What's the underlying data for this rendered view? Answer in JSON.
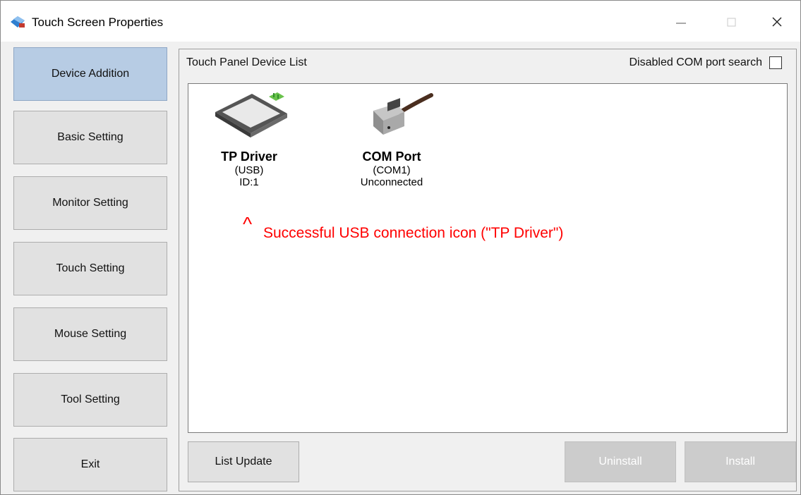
{
  "window": {
    "title": "Touch Screen Properties"
  },
  "sidebar": {
    "items": [
      {
        "label": "Device Addition",
        "active": true
      },
      {
        "label": "Basic Setting",
        "active": false
      },
      {
        "label": "Monitor Setting",
        "active": false
      },
      {
        "label": "Touch Setting",
        "active": false
      },
      {
        "label": "Mouse Setting",
        "active": false
      },
      {
        "label": "Tool Setting",
        "active": false
      },
      {
        "label": "Exit",
        "active": false
      }
    ]
  },
  "panel": {
    "title": "Touch Panel Device List",
    "com_search_label": "Disabled COM port search",
    "com_search_checked": false,
    "devices": [
      {
        "name": "TP Driver",
        "line1": "(USB)",
        "line2": "ID:1",
        "icon": "touch-panel-icon"
      },
      {
        "name": "COM Port",
        "line1": "(COM1)",
        "line2": "Unconnected",
        "icon": "serial-connector-icon"
      }
    ]
  },
  "annotation": {
    "caret": "^",
    "text": "Successful USB connection icon (\"TP Driver\")",
    "color": "#ff0000"
  },
  "buttons": {
    "list_update": "List Update",
    "uninstall": "Uninstall",
    "install": "Install"
  },
  "colors": {
    "active_sidebar": "#b7cce4",
    "button_face": "#e1e1e1",
    "disabled_button": "#cccccc"
  }
}
